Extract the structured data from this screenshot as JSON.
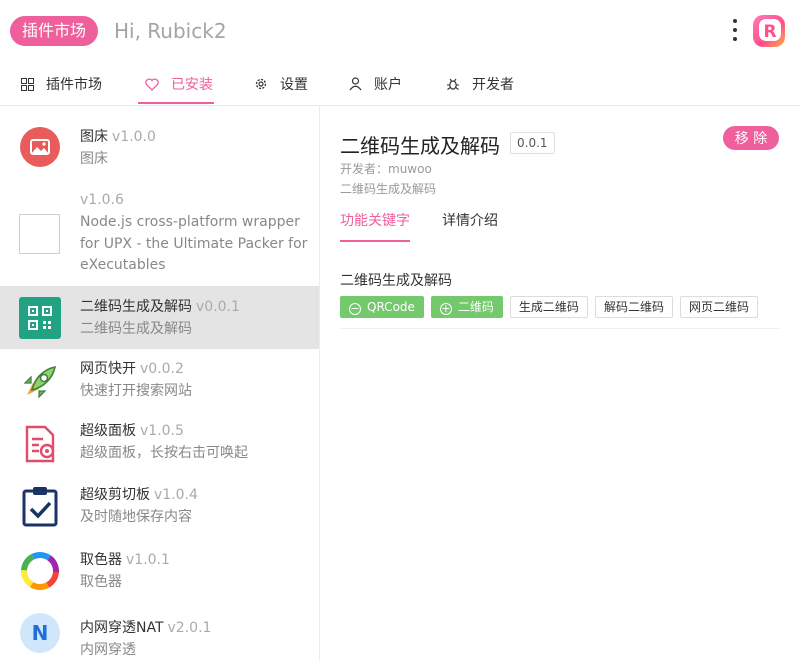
{
  "header": {
    "search_tag": "插件市场",
    "search_placeholder": "Hi, Rubick2",
    "logo_letter": "R"
  },
  "menu": [
    {
      "label": "插件市场",
      "icon": "grid-icon"
    },
    {
      "label": "已安装",
      "icon": "heart-icon"
    },
    {
      "label": "设置",
      "icon": "gear-icon"
    },
    {
      "label": "账户",
      "icon": "user-icon"
    },
    {
      "label": "开发者",
      "icon": "bug-icon"
    }
  ],
  "plugins": [
    {
      "name": "图床",
      "version": "v1.0.0",
      "desc": "图床",
      "icon": "image-icon"
    },
    {
      "name": "",
      "version": "v1.0.6",
      "desc": "Node.js cross-platform wrapper for UPX - the Ultimate Packer for eXecutables",
      "icon": "broken-image-icon"
    },
    {
      "name": "二维码生成及解码",
      "version": "v0.0.1",
      "desc": "二维码生成及解码",
      "icon": "qrcode-icon"
    },
    {
      "name": "网页快开",
      "version": "v0.0.2",
      "desc": "快速打开搜索网站",
      "icon": "rocket-icon"
    },
    {
      "name": "超级面板",
      "version": "v1.0.5",
      "desc": "超级面板，长按右击可唤起",
      "icon": "panel-icon"
    },
    {
      "name": "超级剪切板",
      "version": "v1.0.4",
      "desc": "及时随地保存内容",
      "icon": "clipboard-icon"
    },
    {
      "name": "取色器",
      "version": "v1.0.1",
      "desc": "取色器",
      "icon": "color-ring-icon"
    },
    {
      "name": "内网穿透NAT",
      "version": "v2.0.1",
      "desc": "内网穿透",
      "icon": "nat-icon"
    }
  ],
  "detail": {
    "title": "二维码生成及解码",
    "version": "0.0.1",
    "remove_label": "移 除",
    "developer_label": "开发者：",
    "developer": "muwoo",
    "description": "二维码生成及解码",
    "tabs": [
      "功能关键字",
      "详情介绍"
    ],
    "keyword_title": "二维码生成及解码",
    "keywords": [
      {
        "label": "QRCode",
        "style": "green",
        "symbol": "−"
      },
      {
        "label": "二维码",
        "style": "green",
        "symbol": "+"
      },
      {
        "label": "生成二维码",
        "style": "plain"
      },
      {
        "label": "解码二维码",
        "style": "plain"
      },
      {
        "label": "网页二维码",
        "style": "plain"
      }
    ]
  },
  "colors": {
    "accent": "#ee5f9c",
    "keyword_green": "#73c96b",
    "selected_row": "#e4e4e4"
  }
}
